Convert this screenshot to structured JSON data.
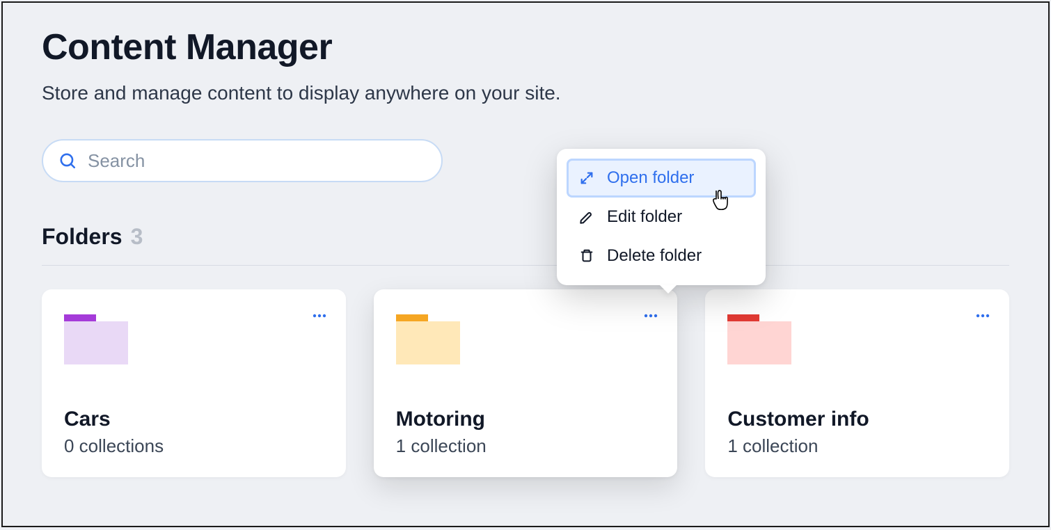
{
  "header": {
    "title": "Content Manager",
    "subtitle": "Store and manage content to display anywhere on your site."
  },
  "search": {
    "placeholder": "Search",
    "value": ""
  },
  "folders_section": {
    "label": "Folders",
    "count": "3"
  },
  "folders": [
    {
      "name": "Cars",
      "subtitle": "0 collections",
      "body_color": "#e9d9f6",
      "tab_color": "#a53bd9"
    },
    {
      "name": "Motoring",
      "subtitle": "1 collection",
      "body_color": "#ffe8b8",
      "tab_color": "#f5a623"
    },
    {
      "name": "Customer info",
      "subtitle": "1 collection",
      "body_color": "#ffd5d3",
      "tab_color": "#e23a33"
    }
  ],
  "context_menu": {
    "open": "Open folder",
    "edit": "Edit folder",
    "delete": "Delete folder"
  }
}
